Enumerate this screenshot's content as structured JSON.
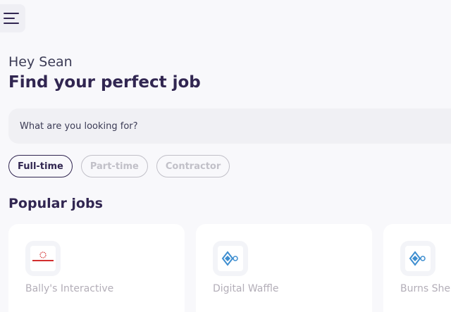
{
  "header": {
    "menu_icon": "hamburger-menu-icon"
  },
  "greeting": "Hey Sean",
  "title": "Find your perfect job",
  "search": {
    "placeholder": "What are you looking for?",
    "value": ""
  },
  "job_types": [
    {
      "label": "Full-time",
      "active": true
    },
    {
      "label": "Part-time",
      "active": false
    },
    {
      "label": "Contractor",
      "active": false
    }
  ],
  "popular": {
    "title": "Popular jobs",
    "cards": [
      {
        "company": "Bally's Interactive",
        "logo_icon": "ballys-logo-icon"
      },
      {
        "company": "Digital Waffle",
        "logo_icon": "digital-waffle-logo-icon"
      },
      {
        "company": "Burns She",
        "logo_icon": "burns-logo-icon"
      }
    ]
  },
  "colors": {
    "primary": "#312651",
    "muted": "#c1c0c8",
    "background": "#f8f8fb"
  }
}
